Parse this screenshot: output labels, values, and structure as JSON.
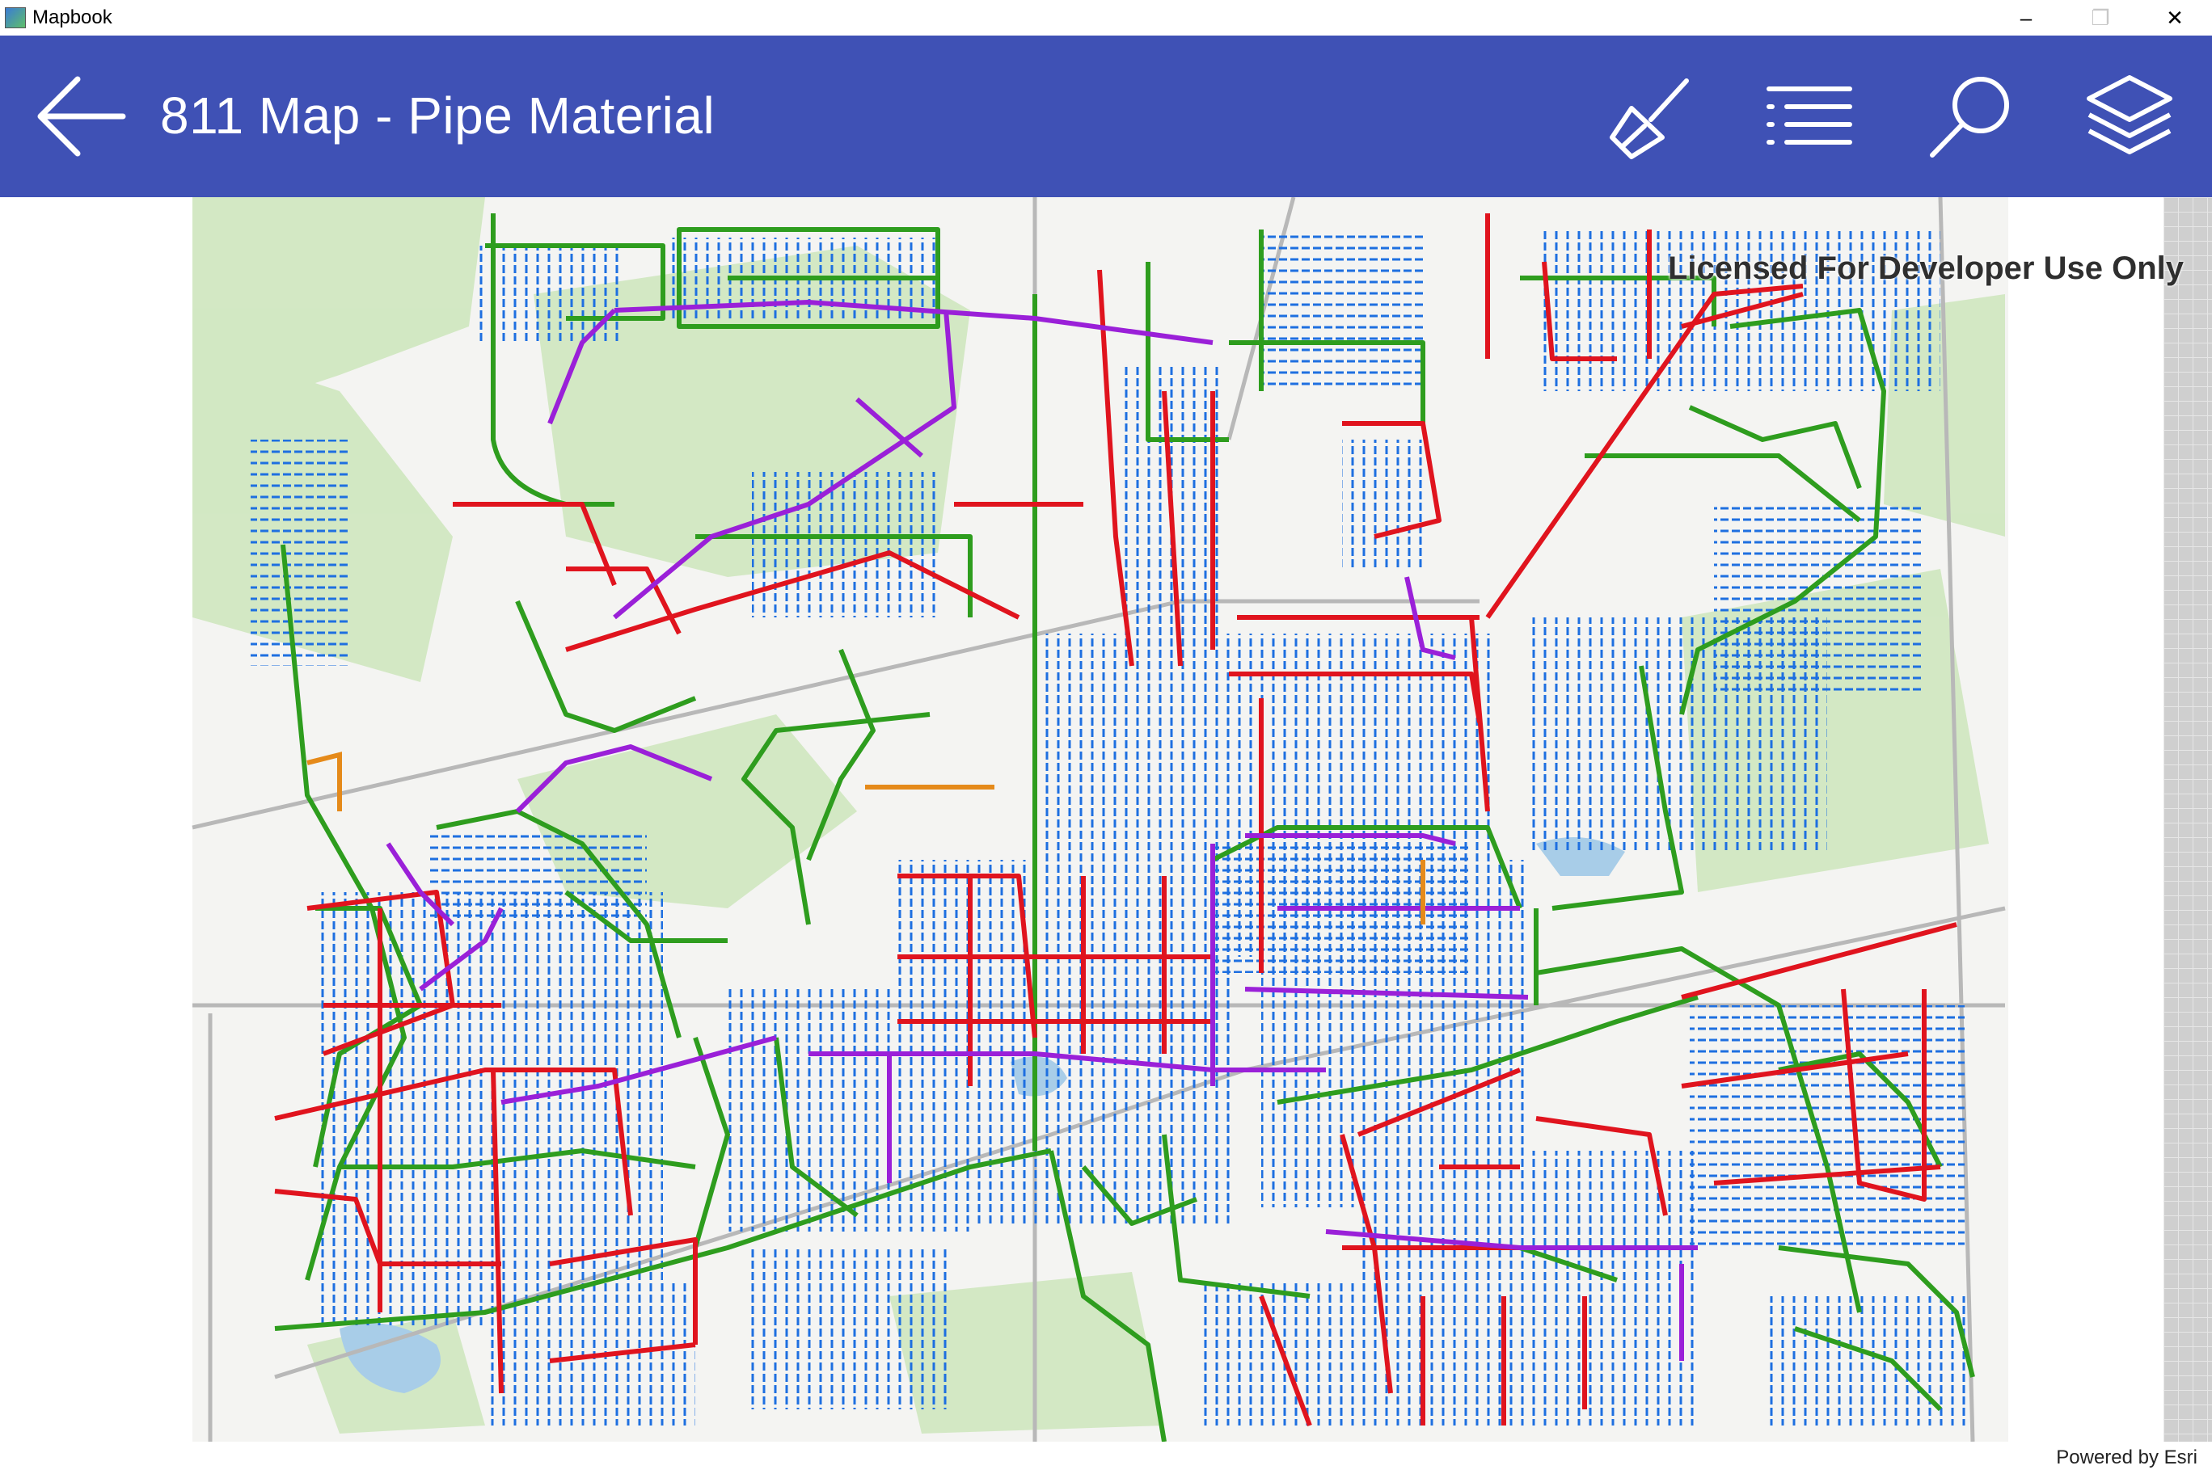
{
  "window": {
    "title": "Mapbook",
    "minimize_glyph": "–",
    "restore_glyph": "❐",
    "close_glyph": "✕"
  },
  "header": {
    "title": "811 Map - Pipe Material",
    "background_color": "#3f51b5",
    "icons": [
      "back-arrow-icon",
      "clear-broom-icon",
      "legend-list-icon",
      "search-icon",
      "layers-icon"
    ]
  },
  "map": {
    "license_text": "Licensed For Developer Use Only",
    "attribution": "Powered by Esri",
    "pipe_colors": {
      "green": "#2e9d1e",
      "red": "#e0141e",
      "purple": "#9a20d8",
      "blue_laterals": "#1e6fe0",
      "orange": "#e58a1a"
    }
  }
}
